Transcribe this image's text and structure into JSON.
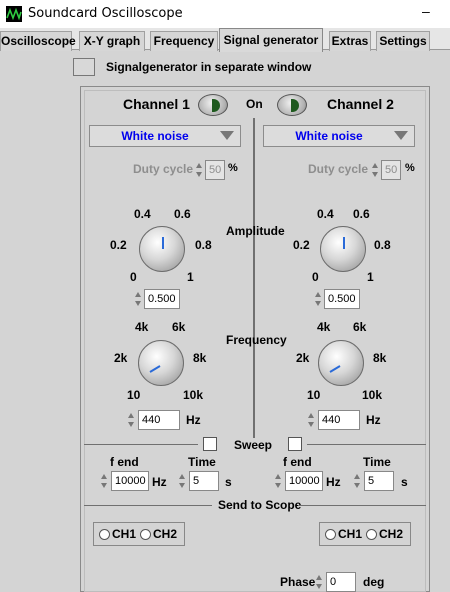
{
  "window": {
    "title": "Soundcard Oscilloscope",
    "minimize": "–"
  },
  "tabs": [
    "Oscilloscope",
    "X-Y graph",
    "Frequency",
    "Signal generator",
    "Extras",
    "Settings"
  ],
  "separate_window_label": "Signalgenerator in separate window",
  "on_label": "On",
  "channel1": {
    "title": "Channel 1",
    "waveform": "White noise",
    "duty_label": "Duty cycle",
    "duty_value": "50",
    "duty_unit": "%",
    "amp_ticks": [
      "0.4",
      "0.6",
      "0.2",
      "0.8",
      "0",
      "1"
    ],
    "amplitude": "0.500",
    "freq_ticks": [
      "4k",
      "6k",
      "2k",
      "8k",
      "10",
      "10k"
    ],
    "frequency": "440",
    "freq_unit": "Hz",
    "fend_label": "f end",
    "fend_value": "10000",
    "fend_unit": "Hz",
    "time_label": "Time",
    "time_value": "5",
    "time_unit": "s",
    "ch1": "CH1",
    "ch2": "CH2"
  },
  "channel2": {
    "title": "Channel 2",
    "waveform": "White noise",
    "duty_label": "Duty cycle",
    "duty_value": "50",
    "duty_unit": "%",
    "amp_ticks": [
      "0.4",
      "0.6",
      "0.2",
      "0.8",
      "0",
      "1"
    ],
    "amplitude": "0.500",
    "freq_ticks": [
      "4k",
      "6k",
      "2k",
      "8k",
      "10",
      "10k"
    ],
    "frequency": "440",
    "freq_unit": "Hz",
    "fend_label": "f end",
    "fend_value": "10000",
    "fend_unit": "Hz",
    "time_label": "Time",
    "time_value": "5",
    "time_unit": "s",
    "ch1": "CH1",
    "ch2": "CH2"
  },
  "center_labels": {
    "amplitude": "Amplitude",
    "frequency": "Frequency",
    "sweep": "Sweep",
    "send_to_scope": "Send to Scope"
  },
  "phase": {
    "label": "Phase",
    "value": "0",
    "unit": "deg"
  },
  "colors": {
    "accent_text": "#0000ee",
    "led_on": "#1e5a1e",
    "knob_pointer": "#2a6ad8"
  }
}
